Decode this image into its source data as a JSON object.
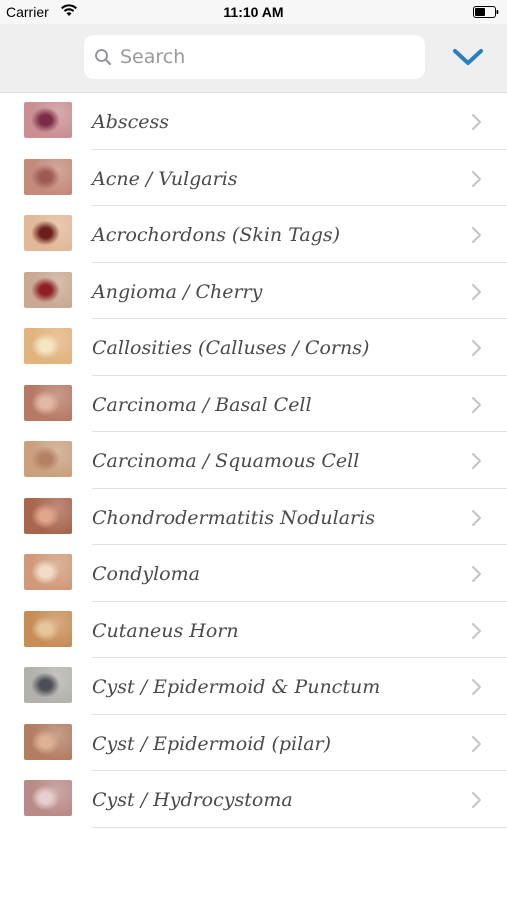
{
  "status_bar": {
    "carrier": "Carrier",
    "time": "11:10 AM",
    "wifi_icon": "wifi-icon",
    "battery_icon": "battery-icon"
  },
  "search": {
    "placeholder": "Search",
    "icon": "search-icon",
    "collapse_icon": "chevron-down-icon",
    "accent_color": "#2b7fc1"
  },
  "conditions": [
    {
      "label": "Abscess",
      "thumb_colors": [
        "#c98f93",
        "#7a2b45"
      ]
    },
    {
      "label": "Acne / Vulgaris",
      "thumb_colors": [
        "#c48a7c",
        "#9b5a52"
      ]
    },
    {
      "label": "Acrochordons (Skin Tags)",
      "thumb_colors": [
        "#e1b998",
        "#6b1f1a"
      ]
    },
    {
      "label": "Angioma / Cherry",
      "thumb_colors": [
        "#c9a993",
        "#8e1f23"
      ]
    },
    {
      "label": "Callosities (Calluses / Corns)",
      "thumb_colors": [
        "#e2b37d",
        "#f4e6c2"
      ]
    },
    {
      "label": "Carcinoma / Basal Cell",
      "thumb_colors": [
        "#b67a64",
        "#e1b8a5"
      ]
    },
    {
      "label": "Carcinoma / Squamous Cell",
      "thumb_colors": [
        "#caa07f",
        "#b48062"
      ]
    },
    {
      "label": "Chondrodermatitis Nodularis",
      "thumb_colors": [
        "#a8664e",
        "#e0a68a"
      ]
    },
    {
      "label": "Condyloma",
      "thumb_colors": [
        "#d09a7a",
        "#f3dcc6"
      ]
    },
    {
      "label": "Cutaneus Horn",
      "thumb_colors": [
        "#c78d57",
        "#e6c79a"
      ]
    },
    {
      "label": "Cyst / Epidermoid & Punctum",
      "thumb_colors": [
        "#b3b1ac",
        "#4d4f58"
      ]
    },
    {
      "label": "Cyst / Epidermoid (pilar)",
      "thumb_colors": [
        "#b27e63",
        "#deb194"
      ]
    },
    {
      "label": "Cyst / Hydrocystoma",
      "thumb_colors": [
        "#b98b87",
        "#e7cfcf"
      ]
    }
  ]
}
